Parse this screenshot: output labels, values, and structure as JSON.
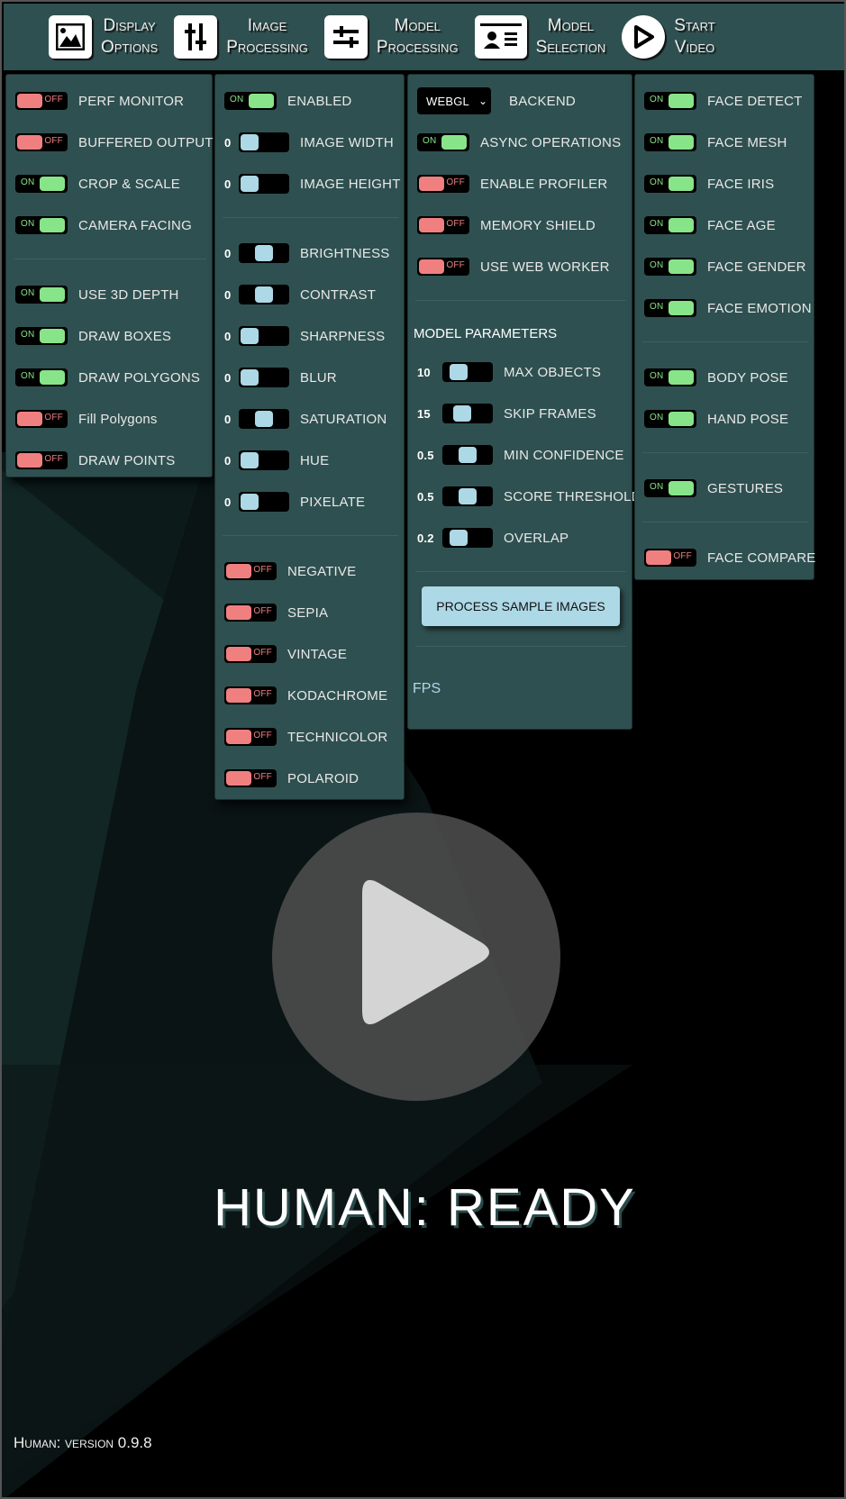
{
  "menubar": {
    "items": [
      {
        "id": "display",
        "line1": "Display",
        "line2": "Options",
        "icon": "image-icon"
      },
      {
        "id": "image",
        "line1": "Image",
        "line2": "Processing",
        "icon": "sliders-vertical-icon"
      },
      {
        "id": "process",
        "line1": "Model",
        "line2": "Processing",
        "icon": "sliders-horizontal-icon"
      },
      {
        "id": "models",
        "line1": "Model",
        "line2": "Selection",
        "icon": "id-card-icon"
      },
      {
        "id": "start",
        "line1": "Start",
        "line2": "Video",
        "icon": "play-circle-icon"
      }
    ]
  },
  "display_options": {
    "group1": [
      {
        "label": "PERF MONITOR",
        "state": "off"
      },
      {
        "label": "BUFFERED OUTPUT",
        "state": "off"
      },
      {
        "label": "CROP & SCALE",
        "state": "on"
      },
      {
        "label": "CAMERA FACING",
        "state": "on"
      }
    ],
    "group2": [
      {
        "label": "USE 3D DEPTH",
        "state": "on"
      },
      {
        "label": "DRAW BOXES",
        "state": "on"
      },
      {
        "label": "DRAW POLYGONS",
        "state": "on"
      },
      {
        "label": "Fill Polygons",
        "state": "off"
      },
      {
        "label": "DRAW POINTS",
        "state": "off"
      }
    ]
  },
  "image_processing": {
    "enabled": {
      "label": "ENABLED",
      "state": "on"
    },
    "size": [
      {
        "label": "IMAGE WIDTH",
        "value": "0",
        "position": 0
      },
      {
        "label": "IMAGE HEIGHT",
        "value": "0",
        "position": 0
      }
    ],
    "adjust": [
      {
        "label": "BRIGHTNESS",
        "value": "0",
        "position": 0.5
      },
      {
        "label": "CONTRAST",
        "value": "0",
        "position": 0.5
      },
      {
        "label": "SHARPNESS",
        "value": "0",
        "position": 0
      },
      {
        "label": "BLUR",
        "value": "0",
        "position": 0
      },
      {
        "label": "SATURATION",
        "value": "0",
        "position": 0.5
      },
      {
        "label": "HUE",
        "value": "0",
        "position": 0
      },
      {
        "label": "PIXELATE",
        "value": "0",
        "position": 0
      }
    ],
    "filters": [
      {
        "label": "NEGATIVE",
        "state": "off"
      },
      {
        "label": "SEPIA",
        "state": "off"
      },
      {
        "label": "VINTAGE",
        "state": "off"
      },
      {
        "label": "KODACHROME",
        "state": "off"
      },
      {
        "label": "TECHNICOLOR",
        "state": "off"
      },
      {
        "label": "POLAROID",
        "state": "off"
      }
    ]
  },
  "model_processing": {
    "backend": {
      "label": "BACKEND",
      "value": "WEBGL"
    },
    "toggles": [
      {
        "label": "ASYNC OPERATIONS",
        "state": "on"
      },
      {
        "label": "ENABLE PROFILER",
        "state": "off"
      },
      {
        "label": "MEMORY SHIELD",
        "state": "off"
      },
      {
        "label": "USE WEB WORKER",
        "state": "off"
      }
    ],
    "parameters_title": "MODEL PARAMETERS",
    "parameters": [
      {
        "label": "MAX OBJECTS",
        "value": "10",
        "position": 0.2
      },
      {
        "label": "SKIP FRAMES",
        "value": "15",
        "position": 0.3
      },
      {
        "label": "MIN CONFIDENCE",
        "value": "0.5",
        "position": 0.5
      },
      {
        "label": "SCORE THRESHOLD",
        "value": "0.5",
        "position": 0.5
      },
      {
        "label": "OVERLAP",
        "value": "0.2",
        "position": 0.2
      }
    ],
    "sample_button": "PROCESS SAMPLE IMAGES",
    "fps_label": "FPS"
  },
  "model_selection": {
    "face": [
      {
        "label": "FACE DETECT",
        "state": "on"
      },
      {
        "label": "FACE MESH",
        "state": "on"
      },
      {
        "label": "FACE IRIS",
        "state": "on"
      },
      {
        "label": "FACE AGE",
        "state": "on"
      },
      {
        "label": "FACE GENDER",
        "state": "on"
      },
      {
        "label": "FACE EMOTION",
        "state": "on"
      }
    ],
    "pose": [
      {
        "label": "BODY POSE",
        "state": "on"
      },
      {
        "label": "HAND POSE",
        "state": "on"
      }
    ],
    "gestures": [
      {
        "label": "GESTURES",
        "state": "on"
      }
    ],
    "compare": [
      {
        "label": "FACE COMPARE",
        "state": "off"
      }
    ]
  },
  "toggle_text": {
    "on": "ON",
    "off": "OFF"
  },
  "status": "HUMAN: READY",
  "version": "Human: version 0.9.8",
  "colors": {
    "panel": "#2f5050",
    "on": "#88e488",
    "off": "#f08080",
    "slider_thumb": "#add8e6",
    "button": "#add8e6"
  }
}
